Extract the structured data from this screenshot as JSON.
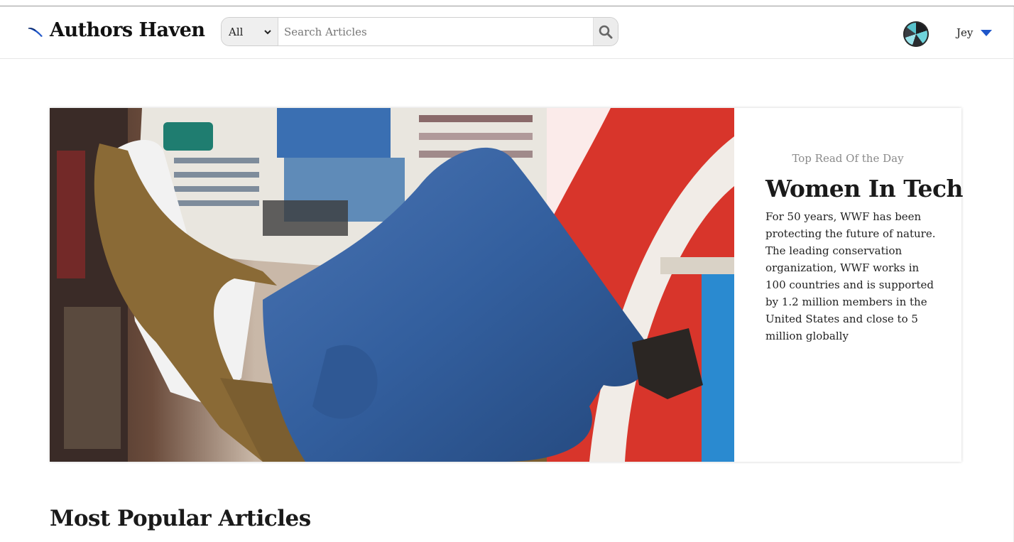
{
  "app": {
    "name": "Authors Haven"
  },
  "search": {
    "category": "All",
    "placeholder": "Search Articles"
  },
  "user": {
    "name": "Jey"
  },
  "hero": {
    "kicker": "Top Read Of the Day",
    "title": "Women In Tech",
    "body": "For 50 years, WWF has been protecting the future of nature. The leading conservation organization, WWF works in 100 countries and is supported by 1.2 million members in the United States and close to 5 million globally"
  },
  "sections": {
    "popular_title": "Most Popular Articles"
  },
  "colors": {
    "accent": "#1f56c9",
    "brand_text": "#111111"
  },
  "icons": {
    "logo": "quill-icon",
    "search": "search-icon",
    "dropdown": "chevron-down-icon",
    "user_menu": "caret-down-icon"
  }
}
